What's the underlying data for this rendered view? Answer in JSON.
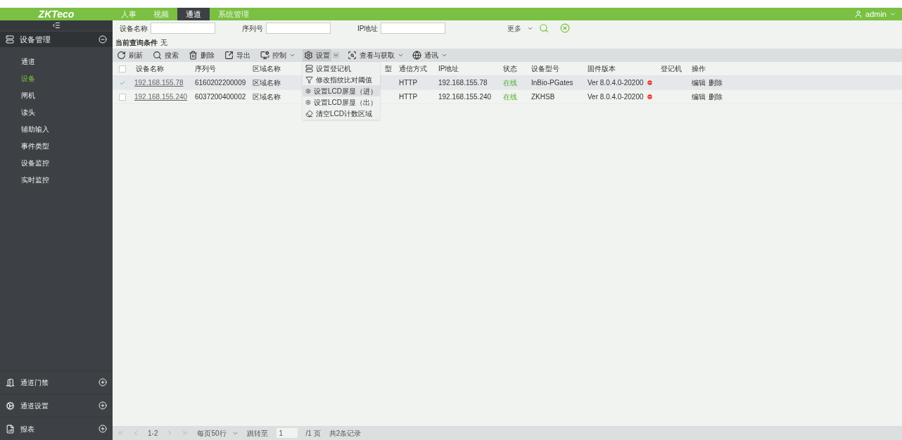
{
  "header": {
    "logo": "ZKTeco",
    "nav": [
      {
        "label": "人事",
        "selected": false
      },
      {
        "label": "视频",
        "selected": false
      },
      {
        "label": "通道",
        "selected": true
      },
      {
        "label": "系统管理",
        "selected": false
      }
    ],
    "user": "admin"
  },
  "sidebar": {
    "groups": [
      {
        "label": "设备管理",
        "expanded": true,
        "items": [
          {
            "label": "通道",
            "selected": false
          },
          {
            "label": "设备",
            "selected": true
          },
          {
            "label": "闸机",
            "selected": false
          },
          {
            "label": "读头",
            "selected": false
          },
          {
            "label": "辅助输入",
            "selected": false
          },
          {
            "label": "事件类型",
            "selected": false
          },
          {
            "label": "设备监控",
            "selected": false
          },
          {
            "label": "实时监控",
            "selected": false
          }
        ]
      }
    ],
    "bottom_groups": [
      {
        "label": "通道门禁",
        "expanded": false
      },
      {
        "label": "通道设置",
        "expanded": false
      },
      {
        "label": "报表",
        "expanded": false
      }
    ]
  },
  "filters": {
    "fields": [
      {
        "label": "设备名称"
      },
      {
        "label": "序列号"
      },
      {
        "label": "IP地址"
      }
    ],
    "more": "更多"
  },
  "condition": {
    "label": "当前查询条件",
    "value": "无"
  },
  "toolbar": [
    {
      "label": "刷新",
      "kind": "refresh",
      "has_menu": false,
      "expanded": false
    },
    {
      "label": "搜索",
      "kind": "search",
      "has_menu": false,
      "expanded": false
    },
    {
      "label": "删除",
      "kind": "delete",
      "has_menu": false,
      "expanded": false
    },
    {
      "label": "导出",
      "kind": "export",
      "has_menu": false,
      "expanded": false
    },
    {
      "label": "控制",
      "kind": "control",
      "has_menu": true,
      "expanded": false
    },
    {
      "label": "设置",
      "kind": "settings",
      "has_menu": true,
      "expanded": true
    },
    {
      "label": "查看与获取",
      "kind": "view",
      "has_menu": true,
      "expanded": false
    },
    {
      "label": "通讯",
      "kind": "comm",
      "has_menu": true,
      "expanded": false
    }
  ],
  "menu": [
    {
      "label": "设置登记机",
      "kind": "register",
      "selected": false
    },
    {
      "label": "修改指纹比对阈值",
      "kind": "threshold",
      "selected": false
    },
    {
      "label": "设置LCD屏显（进）",
      "kind": "gear",
      "selected": true
    },
    {
      "label": "设置LCD屏显（出）",
      "kind": "gear",
      "selected": false
    },
    {
      "label": "清空LCD计数区域",
      "kind": "clear",
      "selected": false
    }
  ],
  "table": {
    "all_checked": false,
    "columns": [
      "设备名称",
      "序列号",
      "区域名称",
      "型",
      "通信方式",
      "IP地址",
      "状态",
      "设备型号",
      "固件版本",
      "登记机",
      "操作"
    ],
    "rows": [
      {
        "checked": true,
        "name": "192.168.155.78",
        "serial": "6160202200009",
        "area": "区域名称",
        "comm": "HTTP",
        "ip": "192.168.155.78",
        "status": "在线",
        "model": "InBio-PGates",
        "firmware": "Ver 8.0.4.0-20200",
        "actions": [
          "编辑",
          "删除"
        ]
      },
      {
        "checked": false,
        "name": "192.168.155.240",
        "serial": "6037200400002",
        "area": "区域名称",
        "comm": "HTTP",
        "ip": "192.168.155.240",
        "status": "在线",
        "model": "ZKHSB",
        "firmware": "Ver 8.0.4.0-20200",
        "actions": [
          "编辑",
          "删除"
        ]
      }
    ]
  },
  "pagination": {
    "range": "1-2",
    "per_page": "每页50行",
    "jump_label": "跳转至",
    "page_value": "1",
    "pages": "/1 页",
    "total": "共2条记录"
  }
}
